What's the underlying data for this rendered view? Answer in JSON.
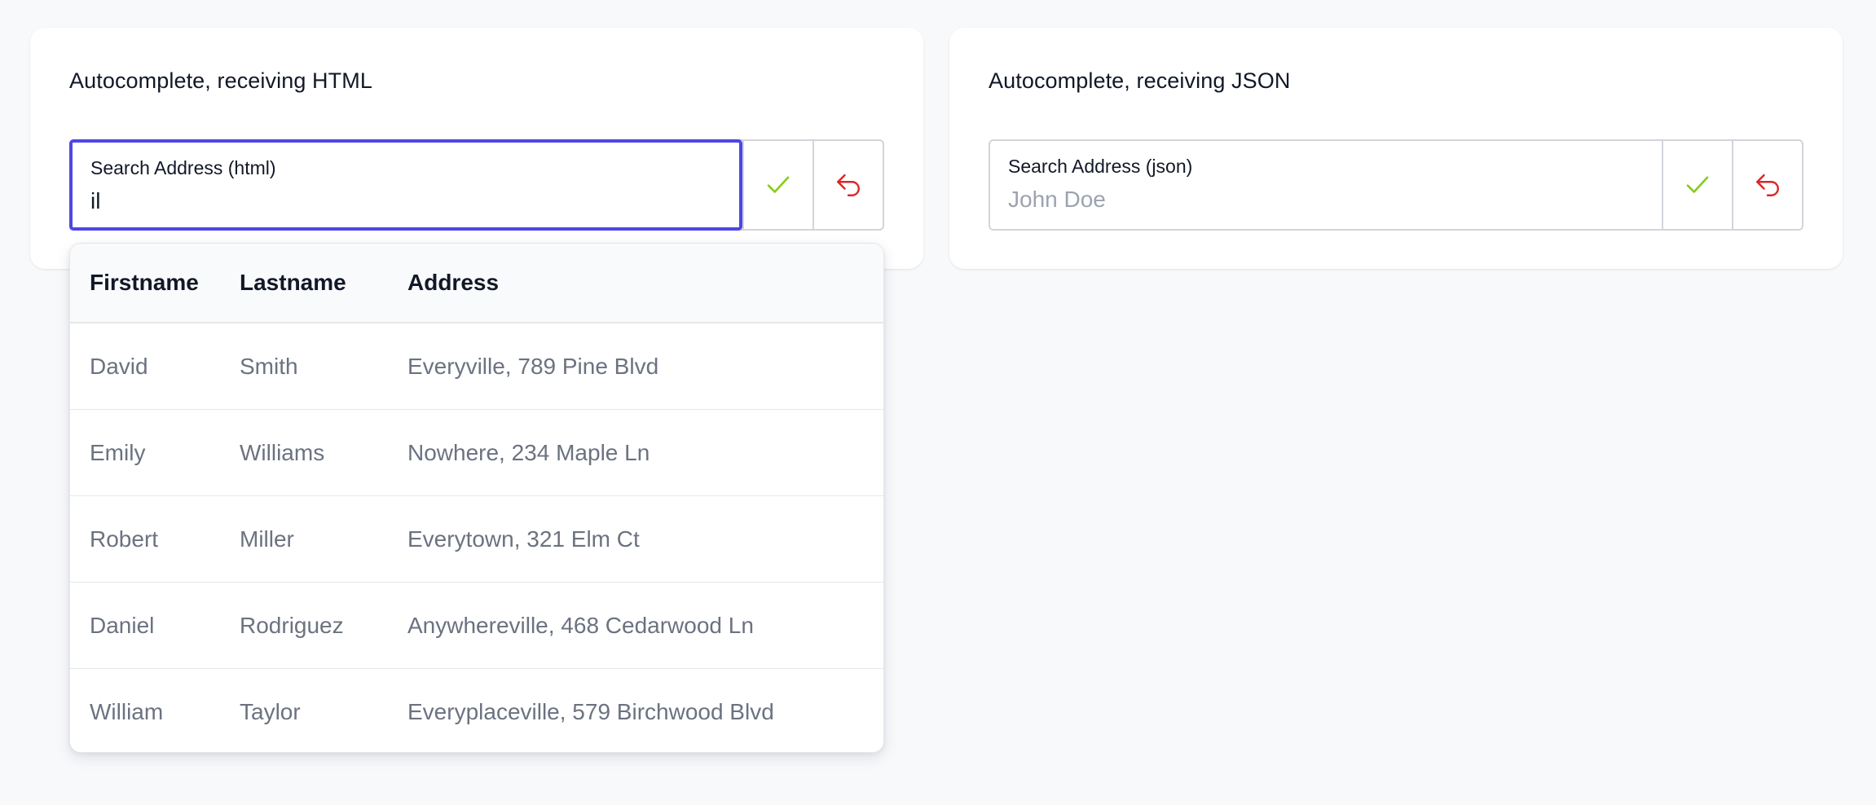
{
  "left_card": {
    "title": "Autocomplete, receiving HTML",
    "field_label": "Search Address (html)",
    "field_value": "il"
  },
  "right_card": {
    "title": "Autocomplete, receiving JSON",
    "field_label": "Search Address (json)",
    "field_placeholder": "John Doe"
  },
  "icons": {
    "confirm": "check-icon",
    "reset": "undo-icon"
  },
  "colors": {
    "focus_border": "#4f46e5",
    "check": "#84cc16",
    "undo": "#dc2626"
  },
  "dropdown": {
    "columns": [
      "Firstname",
      "Lastname",
      "Address"
    ],
    "rows": [
      [
        "David",
        "Smith",
        "Everyville, 789 Pine Blvd"
      ],
      [
        "Emily",
        "Williams",
        "Nowhere, 234 Maple Ln"
      ],
      [
        "Robert",
        "Miller",
        "Everytown, 321 Elm Ct"
      ],
      [
        "Daniel",
        "Rodriguez",
        "Anywhereville, 468 Cedarwood Ln"
      ],
      [
        "William",
        "Taylor",
        "Everyplaceville, 579 Birchwood Blvd"
      ]
    ]
  }
}
